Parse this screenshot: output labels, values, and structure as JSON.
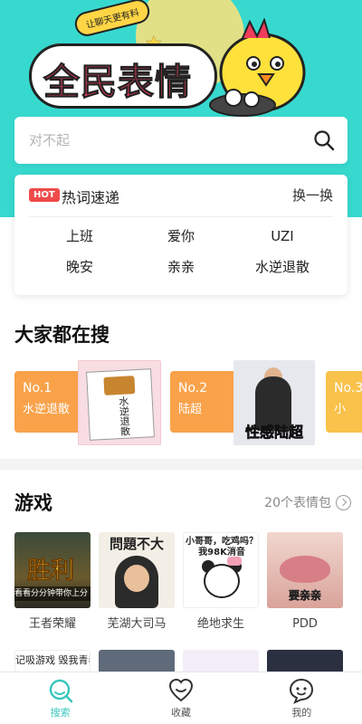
{
  "banner": {
    "logo_text": "全民表情",
    "sticker_text": "让聊天更有料",
    "colors": {
      "background": "#37d9cf",
      "logo": "#ef3d5c",
      "accent": "#ffd545"
    }
  },
  "search": {
    "placeholder": "对不起",
    "icon": "search-icon"
  },
  "hot": {
    "badge": "HOT",
    "title": "热词速递",
    "refresh_label": "换一换",
    "items": [
      "上班",
      "爱你",
      "UZI",
      "晚安",
      "亲亲",
      "水逆退散"
    ]
  },
  "popular": {
    "title": "大家都在搜",
    "cards": [
      {
        "rank": "No.1",
        "name": "水逆退散",
        "image_text": "水逆退散"
      },
      {
        "rank": "No.2",
        "name": "陆超",
        "image_text_a": "性感",
        "image_text_b": "陆超"
      },
      {
        "rank": "No.3",
        "name": "小"
      }
    ]
  },
  "games": {
    "title": "游戏",
    "more_label": "20个表情包",
    "items": [
      {
        "label": "王者荣耀",
        "thumb_text": "胜利",
        "thumb_strip": "看看分分钟带你上分"
      },
      {
        "label": "芜湖大司马",
        "thumb_text": "問題不大"
      },
      {
        "label": "绝地求生",
        "thumb_text": "小哥哥，吃鸡吗？我98K消音"
      },
      {
        "label": "PDD",
        "thumb_text": "要亲亲"
      }
    ],
    "row2": [
      {
        "thumb_text": "记吸游戏 毁我青春"
      },
      {
        "thumb_text": ""
      },
      {
        "thumb_text": ""
      },
      {
        "thumb_text": ""
      }
    ]
  },
  "tabbar": {
    "active_color": "#37c7bd",
    "tabs": [
      {
        "label": "搜索",
        "icon": "search-tab-icon",
        "active": true
      },
      {
        "label": "收藏",
        "icon": "heart-icon",
        "active": false
      },
      {
        "label": "我的",
        "icon": "profile-icon",
        "active": false
      }
    ]
  }
}
